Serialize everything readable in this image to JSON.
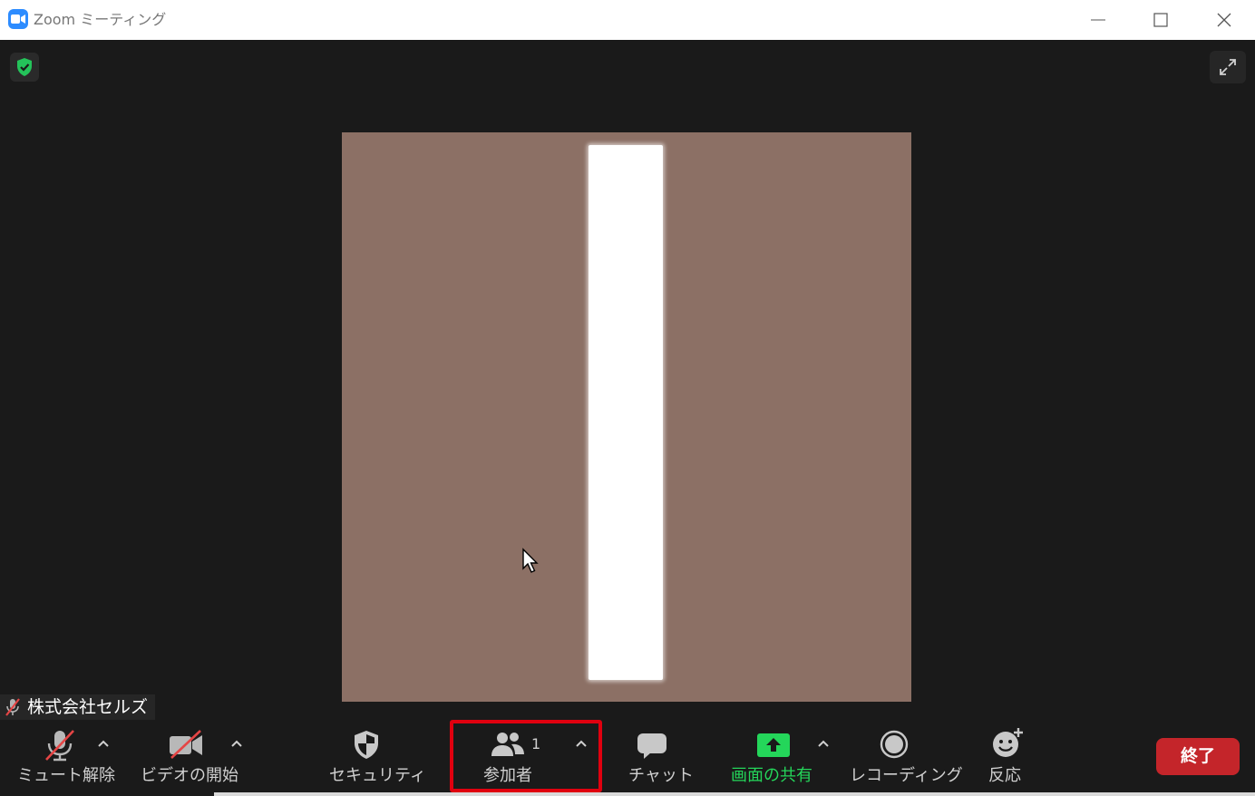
{
  "window": {
    "title": "Zoom ミーティング",
    "accent": "#2d8cff"
  },
  "meeting": {
    "participant_name": "株式会社セルズ",
    "participant_muted": true,
    "tile_color": "#8c7065",
    "security_badge_color": "#24c35a"
  },
  "toolbar": {
    "mute_label": "ミュート解除",
    "video_label": "ビデオの開始",
    "security_label": "セキュリティ",
    "participants_label": "参加者",
    "participants_count": "1",
    "chat_label": "チャット",
    "share_label": "画面の共有",
    "share_color": "#24d65a",
    "record_label": "レコーディング",
    "reactions_label": "反応",
    "end_label": "終了",
    "end_color": "#c4252a",
    "highlight_color": "#e0000f"
  },
  "icons": {
    "app": "zoom-camera-icon",
    "minimize": "minimize-icon",
    "maximize": "maximize-icon",
    "close": "close-icon",
    "security_badge": "shield-check-icon",
    "fullscreen": "expand-icon",
    "mute": "microphone-muted-icon",
    "video": "camera-off-icon",
    "security": "shield-icon",
    "participants": "people-icon",
    "chat": "chat-bubble-icon",
    "share": "share-screen-icon",
    "record": "record-icon",
    "reactions": "emoji-plus-icon"
  }
}
